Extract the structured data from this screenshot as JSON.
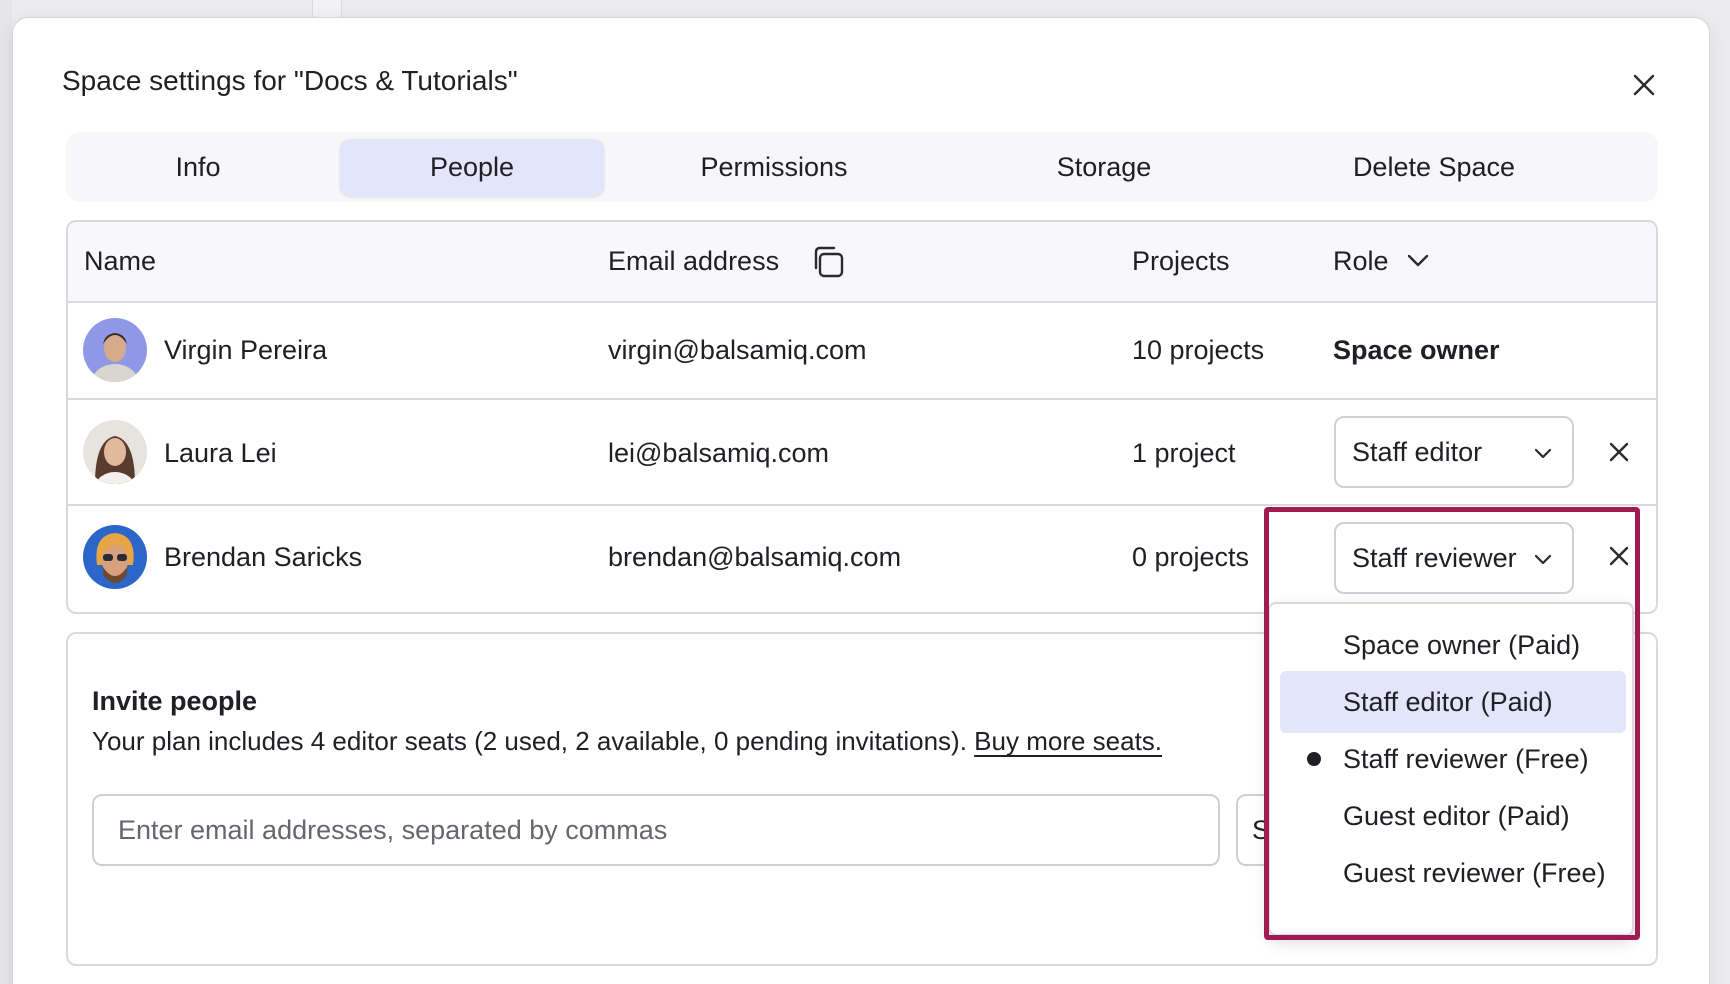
{
  "dialog": {
    "title": "Space settings for \"Docs & Tutorials\"",
    "close_icon": "close-icon"
  },
  "tabs": [
    {
      "label": "Info",
      "active": false
    },
    {
      "label": "People",
      "active": true
    },
    {
      "label": "Permissions",
      "active": false
    },
    {
      "label": "Storage",
      "active": false
    },
    {
      "label": "Delete Space",
      "active": false
    }
  ],
  "table": {
    "headers": {
      "name": "Name",
      "email": "Email address",
      "email_icon": "copy-icon",
      "projects": "Projects",
      "role": "Role",
      "role_icon": "chevron-down-icon"
    },
    "rows": [
      {
        "name": "Virgin Pereira",
        "email": "virgin@balsamiq.com",
        "projects": "10 projects",
        "role": "Space owner",
        "role_editable": false
      },
      {
        "name": "Laura Lei",
        "email": "lei@balsamiq.com",
        "projects": "1 project",
        "role": "Staff editor",
        "role_editable": true
      },
      {
        "name": "Brendan Saricks",
        "email": "brendan@balsamiq.com",
        "projects": "0 projects",
        "role": "Staff reviewer",
        "role_editable": true
      }
    ]
  },
  "invite": {
    "title": "Invite people",
    "description": "Your plan includes 4 editor seats (2 used, 2 available, 0 pending invitations).",
    "link": "Buy more seats.",
    "email_placeholder": "Enter email addresses, separated by commas",
    "send_button_partial": "S"
  },
  "role_dropdown": {
    "options": [
      {
        "label": "Space owner (Paid)",
        "selected": false,
        "hovered": false
      },
      {
        "label": "Staff editor (Paid)",
        "selected": false,
        "hovered": true
      },
      {
        "label": "Staff reviewer (Free)",
        "selected": true,
        "hovered": false
      },
      {
        "label": "Guest editor (Paid)",
        "selected": false,
        "hovered": false
      },
      {
        "label": "Guest reviewer (Free)",
        "selected": false,
        "hovered": false
      }
    ]
  },
  "colors": {
    "accent_tab": "#e3e6fb",
    "highlight_border": "#a01b52",
    "text": "#1f1f24"
  }
}
